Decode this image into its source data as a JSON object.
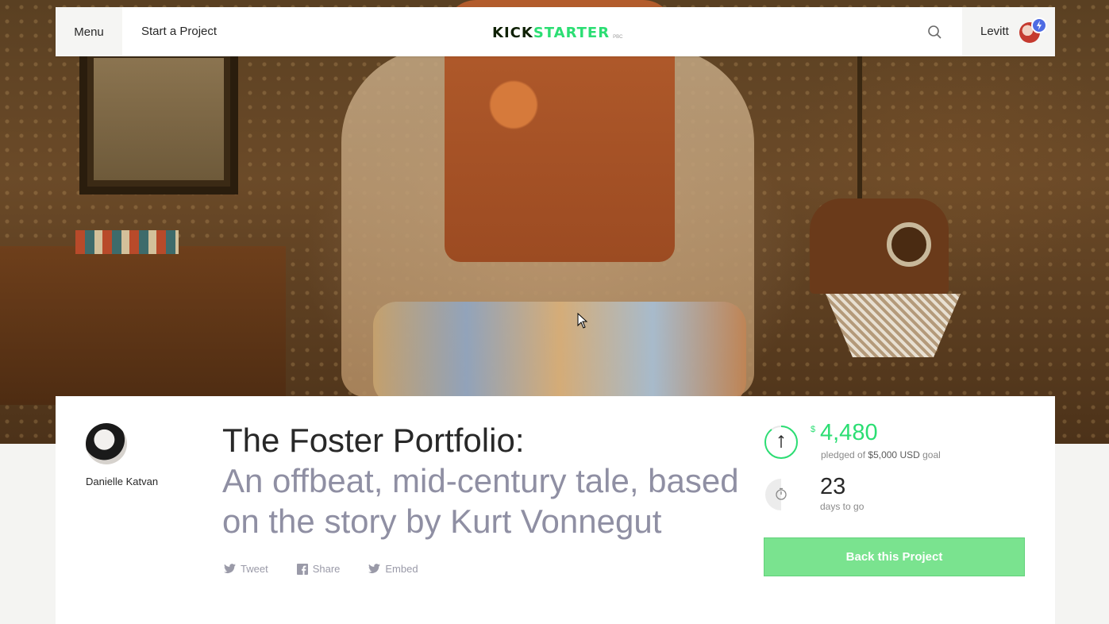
{
  "nav": {
    "menu_label": "Menu",
    "start_project_label": "Start a Project",
    "logo_part1": "KICK",
    "logo_part2": "STARTER",
    "logo_suffix": "PBC",
    "user_name": "Levitt"
  },
  "project": {
    "creator_name": "Danielle Katvan",
    "title": "The Foster Portfolio:",
    "subtitle": "An offbeat, mid-century tale, based on the story by Kurt Vonnegut",
    "share": {
      "tweet_label": "Tweet",
      "share_label": "Share",
      "embed_label": "Embed"
    }
  },
  "stats": {
    "currency_symbol": "$",
    "pledged_amount": "4,480",
    "pledged_prefix": "pledged of",
    "goal_amount": "$5,000 USD",
    "goal_suffix": "goal",
    "funded_fraction": 0.896,
    "days_value": "23",
    "days_label": "days to go",
    "back_button_label": "Back this Project"
  },
  "colors": {
    "brand_green": "#2bde73",
    "button_green": "#7ae38f",
    "text_dark": "#282828",
    "subtitle_gray": "#8f8fa3"
  }
}
